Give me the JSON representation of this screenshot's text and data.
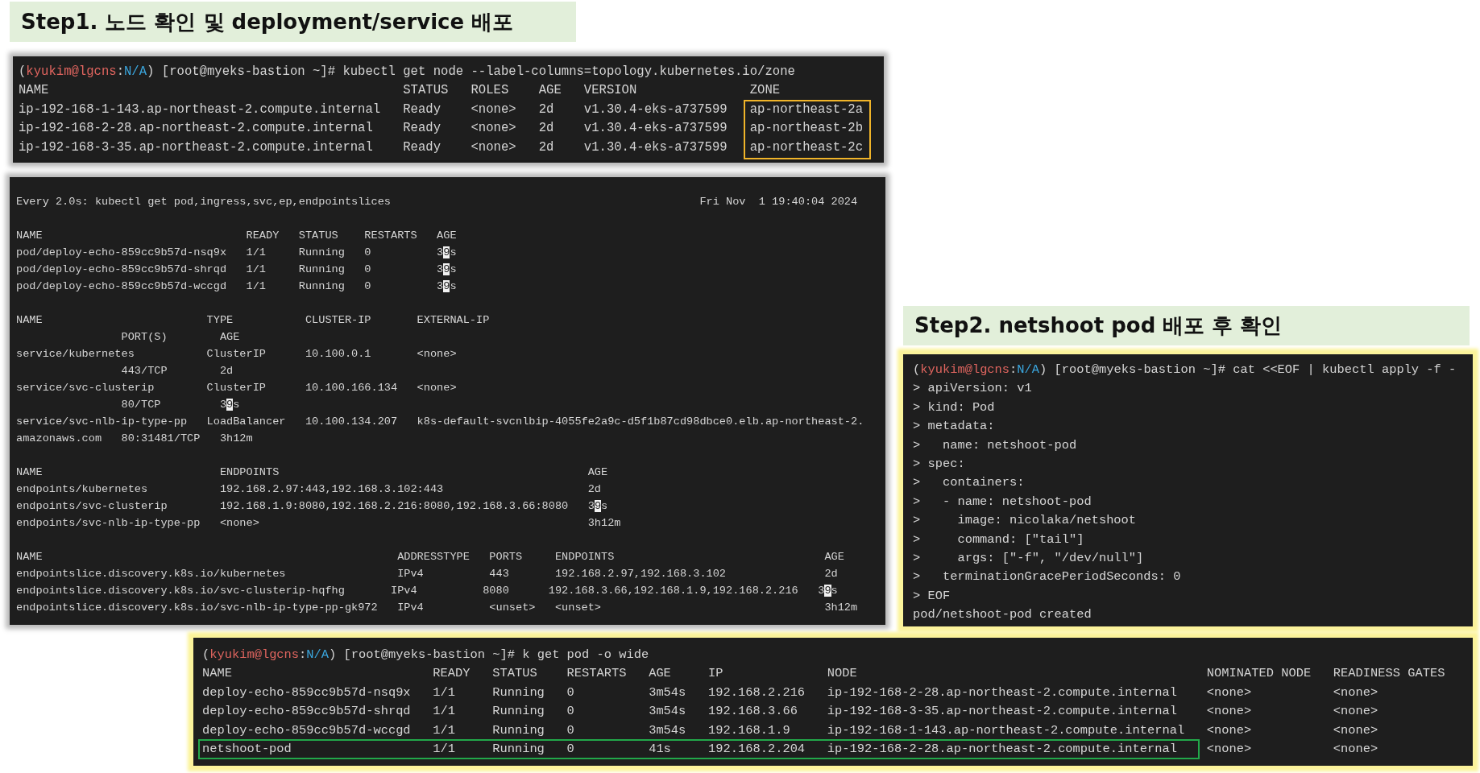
{
  "step1_title": "Step1. 노드 확인 및 deployment/service 배포",
  "node_terminal": {
    "prompt": {
      "open": "(",
      "user": "kyukim@lgcns",
      "sep": ":",
      "context": "N/A",
      "close": ")",
      "command": " [root@myeks-bastion ~]# kubectl get node --label-columns=topology.kubernetes.io/zone"
    },
    "header": "NAME                                               STATUS   ROLES    AGE   VERSION               ZONE",
    "rows": [
      "ip-192-168-1-143.ap-northeast-2.compute.internal   Ready    <none>   2d    v1.30.4-eks-a737599   ap-northeast-2a",
      "ip-192-168-2-28.ap-northeast-2.compute.internal    Ready    <none>   2d    v1.30.4-eks-a737599   ap-northeast-2b",
      "ip-192-168-3-35.ap-northeast-2.compute.internal    Ready    <none>   2d    v1.30.4-eks-a737599   ap-northeast-2c"
    ],
    "zone_column_highlighted": true
  },
  "watch_terminal": {
    "header": "Every 2.0s: kubectl get pod,ingress,svc,ep,endpointslices                                               Fri Nov  1 19:40:04 2024",
    "sections": [
      {
        "lines": [
          "NAME                               READY   STATUS    RESTARTS   AGE",
          {
            "text": "pod/deploy-echo-859cc9b57d-nsq9x   1/1     Running   0          3",
            "cursor": "9",
            "after": "s"
          },
          {
            "text": "pod/deploy-echo-859cc9b57d-shrqd   1/1     Running   0          3",
            "cursor": "9",
            "after": "s"
          },
          {
            "text": "pod/deploy-echo-859cc9b57d-wccgd   1/1     Running   0          3",
            "cursor": "9",
            "after": "s"
          }
        ]
      },
      {
        "lines": [
          "NAME                         TYPE           CLUSTER-IP       EXTERNAL-IP",
          "                PORT(S)        AGE",
          "service/kubernetes           ClusterIP      10.100.0.1       <none>",
          "                443/TCP        2d",
          "service/svc-clusterip        ClusterIP      10.100.166.134   <none>",
          {
            "text": "                80/TCP         3",
            "cursor": "9",
            "after": "s"
          },
          "service/svc-nlb-ip-type-pp   LoadBalancer   10.100.134.207   k8s-default-svcnlbip-4055fe2a9c-d5f1b87cd98dbce0.elb.ap-northeast-2.",
          "amazonaws.com   80:31481/TCP   3h12m"
        ]
      },
      {
        "lines": [
          "NAME                           ENDPOINTS                                               AGE",
          "endpoints/kubernetes           192.168.2.97:443,192.168.3.102:443                      2d",
          {
            "text": "endpoints/svc-clusterip        192.168.1.9:8080,192.168.2.216:8080,192.168.3.66:8080   3",
            "cursor": "9",
            "after": "s"
          },
          "endpoints/svc-nlb-ip-type-pp   <none>                                                  3h12m"
        ]
      },
      {
        "lines": [
          "NAME                                                      ADDRESSTYPE   PORTS     ENDPOINTS                                AGE",
          "endpointslice.discovery.k8s.io/kubernetes                 IPv4          443       192.168.2.97,192.168.3.102               2d",
          {
            "text": "endpointslice.discovery.k8s.io/svc-clusterip-hqfhg       IPv4          8080      192.168.3.66,192.168.1.9,192.168.2.216   3",
            "cursor": "9",
            "after": "s"
          },
          "endpointslice.discovery.k8s.io/svc-nlb-ip-type-pp-gk972   IPv4          <unset>   <unset>                                  3h12m"
        ]
      }
    ]
  },
  "step2_title": "Step2. netshoot pod 배포 후 확인",
  "apply_terminal": {
    "prompt": {
      "open": "(",
      "user": "kyukim@lgcns",
      "sep": ":",
      "context": "N/A",
      "close": ")",
      "command": " [root@myeks-bastion ~]# cat <<EOF | kubectl apply -f -"
    },
    "lines": [
      "> apiVersion: v1",
      "> kind: Pod",
      "> metadata:",
      ">   name: netshoot-pod",
      "> spec:",
      ">   containers:",
      ">   - name: netshoot-pod",
      ">     image: nicolaka/netshoot",
      ">     command: [\"tail\"]",
      ">     args: [\"-f\", \"/dev/null\"]",
      ">   terminationGracePeriodSeconds: 0",
      "> EOF",
      "pod/netshoot-pod created"
    ]
  },
  "pods_terminal": {
    "prompt": {
      "open": "(",
      "user": "kyukim@lgcns",
      "sep": ":",
      "context": "N/A",
      "close": ")",
      "command": " [root@myeks-bastion ~]# k get pod -o wide"
    },
    "header": "NAME                           READY   STATUS    RESTARTS   AGE     IP              NODE                                               NOMINATED NODE   READINESS GATES",
    "rows": [
      {
        "text": "deploy-echo-859cc9b57d-nsq9x   1/1     Running   0          3m54s   192.168.2.216   ip-192-168-2-28.ap-northeast-2.compute.internal    <none>           <none>",
        "highlighted": false
      },
      {
        "text": "deploy-echo-859cc9b57d-shrqd   1/1     Running   0          3m54s   192.168.3.66    ip-192-168-3-35.ap-northeast-2.compute.internal    <none>           <none>",
        "highlighted": false
      },
      {
        "text": "deploy-echo-859cc9b57d-wccgd   1/1     Running   0          3m54s   192.168.1.9     ip-192-168-1-143.ap-northeast-2.compute.internal   <none>           <none>",
        "highlighted": false
      },
      {
        "text": "netshoot-pod                   1/1     Running   0          41s     192.168.2.204   ip-192-168-2-28.ap-northeast-2.compute.internal    <none>           <none>",
        "highlighted": true
      }
    ]
  }
}
